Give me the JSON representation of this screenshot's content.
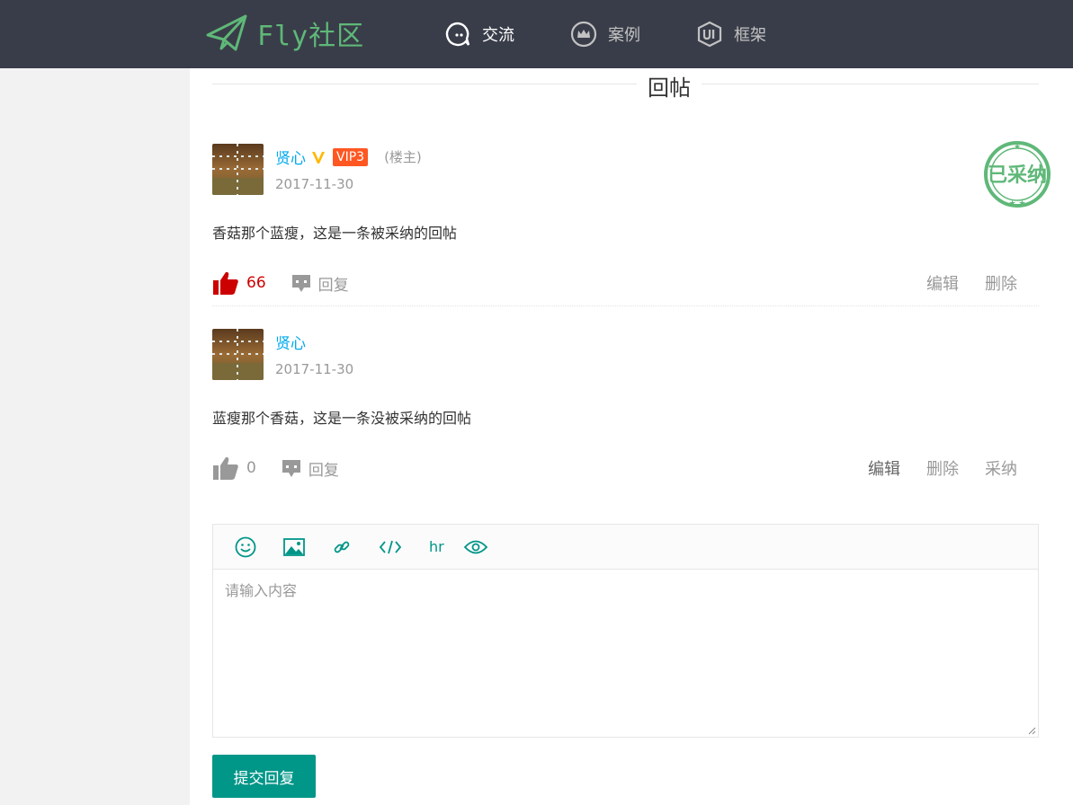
{
  "header": {
    "logo_text": "Fly社区",
    "nav": [
      {
        "label": "交流",
        "icon": "chat-icon",
        "active": true
      },
      {
        "label": "案例",
        "icon": "crown-icon",
        "active": false
      },
      {
        "label": "框架",
        "icon": "ui-icon",
        "active": false
      }
    ]
  },
  "section": {
    "title": "回帖"
  },
  "replies": [
    {
      "username": "贤心",
      "verified": true,
      "vip": "VIP3",
      "owner_label": "(楼主)",
      "date": "2017-11-30",
      "content": "香菇那个蓝瘦，这是一条被采纳的回帖",
      "likes": "66",
      "liked": true,
      "reply_label": "回复",
      "accepted": true,
      "stamp_text": "已采纳",
      "admin_actions": [
        "编辑",
        "删除"
      ]
    },
    {
      "username": "贤心",
      "date": "2017-11-30",
      "content": "蓝瘦那个香菇，这是一条没被采纳的回帖",
      "likes": "0",
      "liked": false,
      "reply_label": "回复",
      "admin_actions": [
        "编辑",
        "删除",
        "采纳"
      ]
    }
  ],
  "editor": {
    "tools": [
      {
        "icon": "emoji-icon"
      },
      {
        "icon": "image-icon"
      },
      {
        "icon": "link-icon"
      },
      {
        "icon": "code-icon"
      },
      {
        "icon": "hr-icon",
        "label": "hr"
      },
      {
        "icon": "preview-icon"
      }
    ],
    "placeholder": "请输入内容",
    "submit_label": "提交回复"
  },
  "colors": {
    "header_bg": "#393d49",
    "logo": "#5fb878",
    "username": "#01aaed",
    "vip": "#ff5722",
    "liked": "#cc0000",
    "accent": "#009688"
  }
}
